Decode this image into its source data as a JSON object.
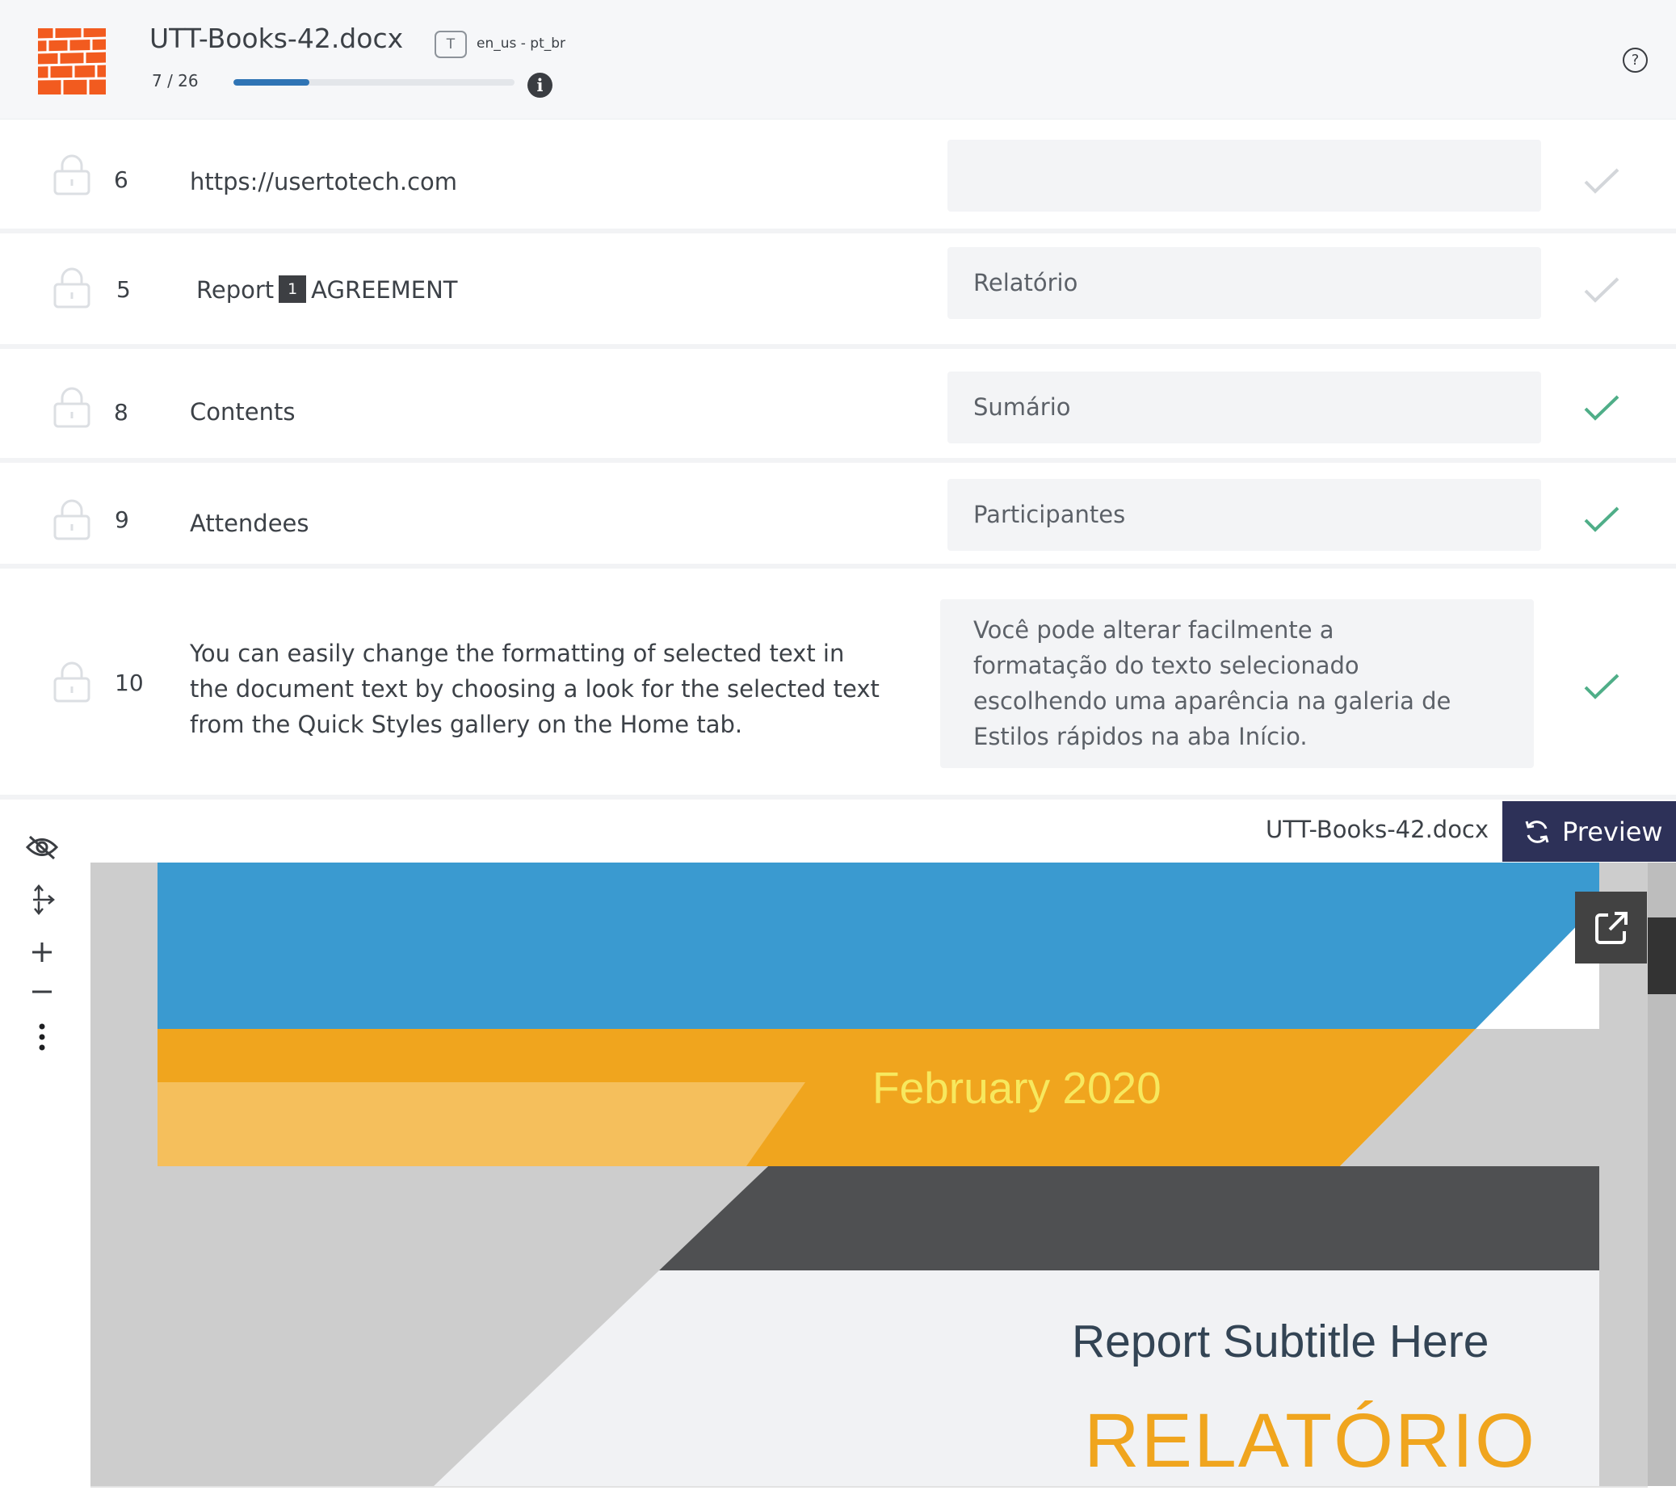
{
  "header": {
    "file_name": "UTT-Books-42.docx",
    "progress_text": "7 / 26",
    "progress_fraction": 0.269,
    "t_badge": "T",
    "language_pair": "en_us - pt_br",
    "info_icon": "i",
    "help_icon": "?"
  },
  "segments": [
    {
      "number": "6",
      "source": "https://usertotech.com",
      "target": "",
      "confirmed": false
    },
    {
      "number": "5",
      "source_before": "Report",
      "tag": "1",
      "source_after": "AGREEMENT",
      "target": "Relatório",
      "confirmed": false
    },
    {
      "number": "8",
      "source": "Contents",
      "target": "Sumário",
      "confirmed": true
    },
    {
      "number": "9",
      "source": "Attendees",
      "target": "Participantes",
      "confirmed": true
    },
    {
      "number": "10",
      "source": "You can easily change the formatting of selected text in the document text by choosing a look for the selected text from the Quick Styles gallery on the Home tab.",
      "target": "Você pode alterar facilmente a formatação do texto selecionado escolhendo uma aparência na galeria de Estilos rápidos na aba Início.",
      "confirmed": true
    }
  ],
  "preview": {
    "file_name": "UTT-Books-42.docx",
    "button_label": "Preview",
    "page": {
      "date": "February 2020",
      "subtitle": "Report Subtitle Here",
      "title": "RELATÓRIO"
    }
  },
  "colors": {
    "accent_blue": "#2f74b5",
    "check_confirmed": "#4fae88",
    "check_unconfirmed": "#d3d6da",
    "preview_button": "#2d3158",
    "page_blue": "#3a9ad0",
    "page_orange": "#f0a51e",
    "page_light_orange": "#f5bf5c",
    "page_dark": "#4f5052"
  },
  "icons": {
    "logo": "brick-wall-logo",
    "lock": "lock-icon",
    "check": "check-icon",
    "hide": "eye-off-icon",
    "move": "move-arrows-icon",
    "zoom_in": "plus-icon",
    "zoom_out": "minus-icon",
    "more": "more-vertical-icon",
    "refresh": "refresh-icon",
    "external": "external-link-icon"
  }
}
